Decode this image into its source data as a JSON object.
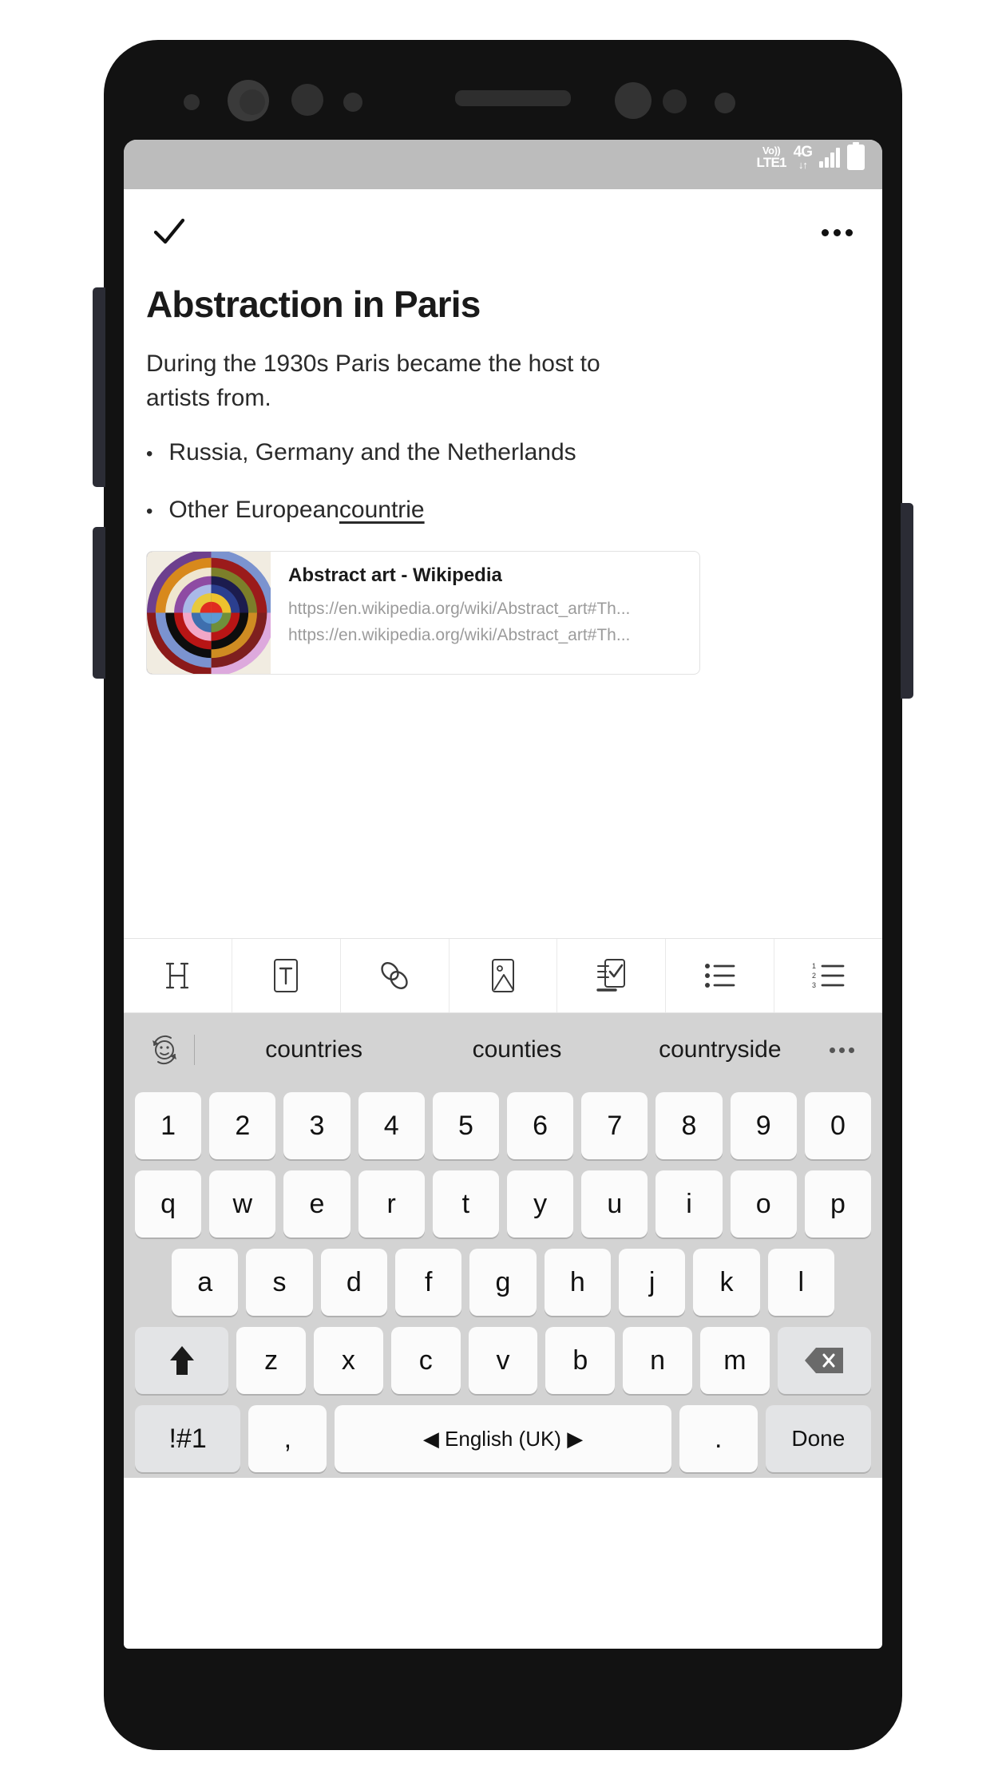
{
  "status_bar": {
    "volte_top": "Vo))",
    "volte_bottom": "LTE1",
    "network_top": "4G",
    "network_bottom": "↓↑",
    "signal_icon": "signal-bars-icon",
    "battery_icon": "battery-icon"
  },
  "editor": {
    "save_icon": "checkmark-icon",
    "overflow_icon": "more-options-icon",
    "title": "Abstraction in Paris",
    "paragraph": "During the 1930s Paris became the host to artists from.",
    "bullets": [
      {
        "bullet": "•",
        "text": "Russia, Germany and the Netherlands",
        "composing": ""
      },
      {
        "bullet": "•",
        "text": "Other European ",
        "composing": "countrie"
      }
    ],
    "link_card": {
      "title": "Abstract art - Wikipedia",
      "url_line_1": "https://en.wikipedia.org/wiki/Abstract_art#Th...",
      "url_line_2": "https://en.wikipedia.org/wiki/Abstract_art#Th...",
      "thumbnail_name": "abstract-art-thumbnail"
    }
  },
  "format_toolbar": {
    "buttons": [
      {
        "name": "heading-button",
        "icon": "heading-h-icon",
        "label": "H"
      },
      {
        "name": "text-style-button",
        "icon": "text-format-t-icon",
        "label": "T"
      },
      {
        "name": "insert-link-button",
        "icon": "link-chain-icon",
        "label": ""
      },
      {
        "name": "insert-image-button",
        "icon": "image-picture-icon",
        "label": ""
      },
      {
        "name": "insert-checklist-button",
        "icon": "checklist-icon",
        "label": ""
      },
      {
        "name": "bullet-list-button",
        "icon": "bullet-list-icon",
        "label": ""
      },
      {
        "name": "numbered-list-button",
        "icon": "numbered-list-icon",
        "label": ""
      }
    ]
  },
  "keyboard": {
    "emoji_icon": "emoji-rotate-icon",
    "more_suggestions_icon": "more-suggestions-icon",
    "suggestions": [
      "countries",
      "counties",
      "countryside"
    ],
    "row_numbers": [
      "1",
      "2",
      "3",
      "4",
      "5",
      "6",
      "7",
      "8",
      "9",
      "0"
    ],
    "row_letters_1": [
      "q",
      "w",
      "e",
      "r",
      "t",
      "y",
      "u",
      "i",
      "o",
      "p"
    ],
    "row_letters_2": [
      "a",
      "s",
      "d",
      "f",
      "g",
      "h",
      "j",
      "k",
      "l"
    ],
    "row_letters_3": [
      "z",
      "x",
      "c",
      "v",
      "b",
      "n",
      "m"
    ],
    "shift_key": {
      "name": "shift-key",
      "icon": "shift-arrow-icon"
    },
    "backspace_key": {
      "name": "backspace-key",
      "icon": "backspace-icon"
    },
    "symbols_key": "!#1",
    "comma_key": ",",
    "space_key": "◀ English (UK) ▶",
    "period_key": ".",
    "done_key": "Done"
  },
  "colors": {
    "status_bar_bg": "#bcbcbc",
    "keyboard_bg": "#d3d3d3",
    "key_bg": "#fbfbfb",
    "fn_key_bg": "#e3e4e6",
    "text_primary": "#1a1a1a",
    "url_gray": "#9b9b9b",
    "frame_black": "#121212"
  }
}
